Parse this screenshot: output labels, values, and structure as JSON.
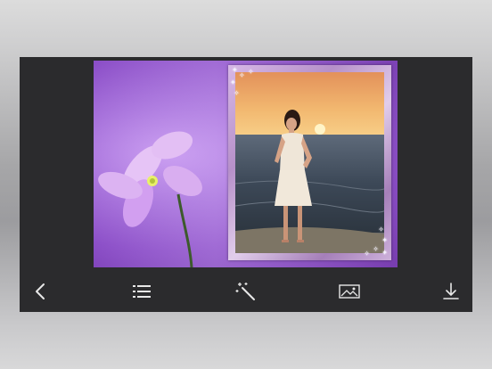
{
  "toolbar": {
    "items": [
      {
        "name": "back",
        "icon": "chevron-left-icon"
      },
      {
        "name": "frames-list",
        "icon": "list-icon"
      },
      {
        "name": "effects",
        "icon": "magic-wand-icon"
      },
      {
        "name": "gallery",
        "icon": "image-icon"
      },
      {
        "name": "save",
        "icon": "download-icon"
      }
    ]
  },
  "colors": {
    "toolbar_bg": "#2b2b2d",
    "icon": "#e8e8e8",
    "frame": "#c9a8da"
  }
}
